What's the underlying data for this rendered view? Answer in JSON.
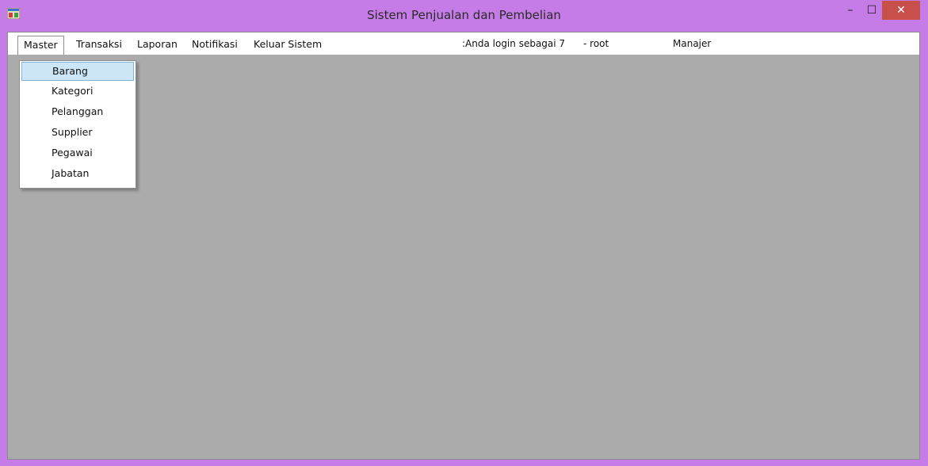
{
  "window": {
    "title": "Sistem Penjualan dan Pembelian",
    "controls": {
      "minimize": "–",
      "maximize": "☐",
      "close": "✕"
    },
    "colors": {
      "frame": "#c67ce6",
      "close": "#c7504a",
      "client": "#ababab"
    }
  },
  "menubar": {
    "items": [
      {
        "label": "Master"
      },
      {
        "label": "Transaksi"
      },
      {
        "label": "Laporan"
      },
      {
        "label": "Notifikasi"
      },
      {
        "label": "Keluar Sistem"
      }
    ],
    "status": {
      "login_text": ":Anda login sebagai 7",
      "user_text": "-  root",
      "role_text": "Manajer"
    }
  },
  "dropdown": {
    "items": [
      {
        "label": "Barang"
      },
      {
        "label": "Kategori"
      },
      {
        "label": "Pelanggan"
      },
      {
        "label": "Supplier"
      },
      {
        "label": "Pegawai"
      },
      {
        "label": "Jabatan"
      }
    ],
    "highlighted": "Barang"
  }
}
